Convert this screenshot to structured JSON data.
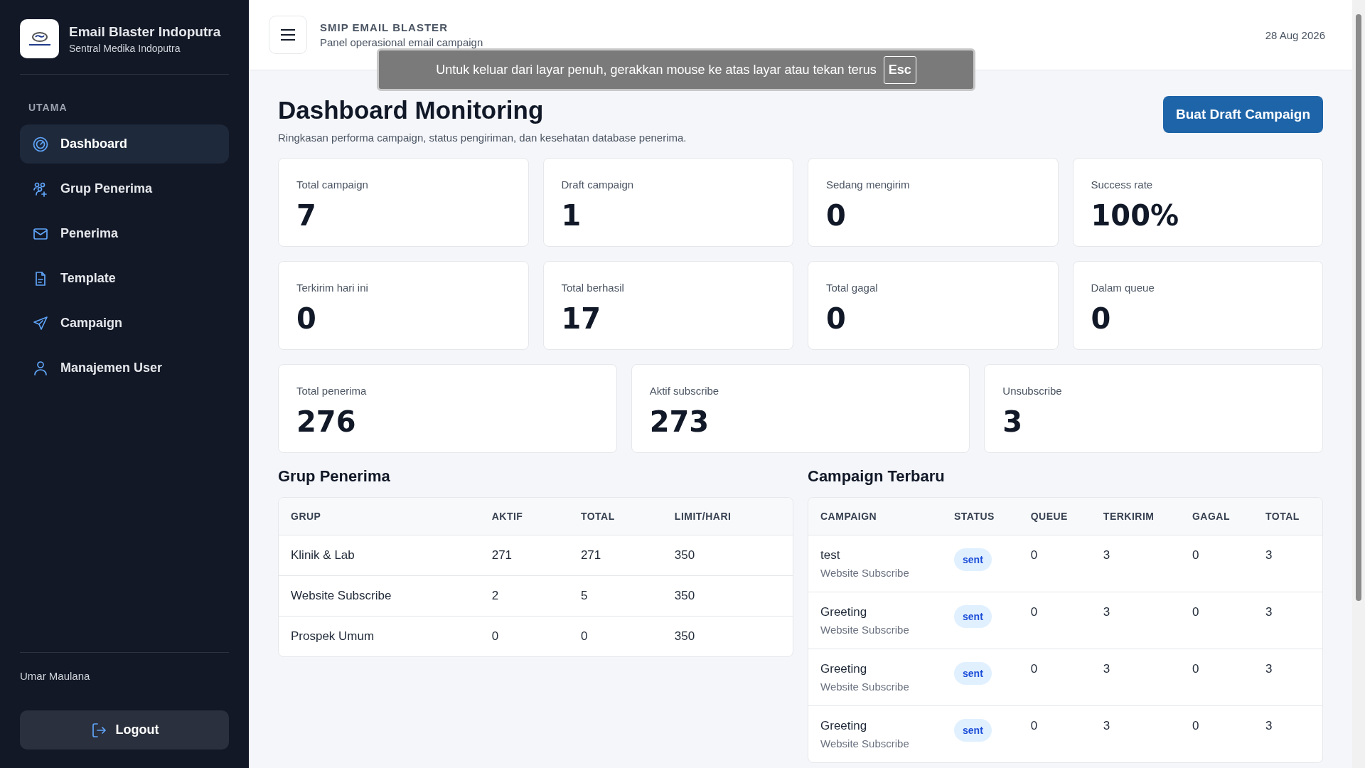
{
  "sidebar": {
    "brand": {
      "title": "Email Blaster Indoputra",
      "subtitle": "Sentral Medika Indoputra"
    },
    "section_label": "UTAMA",
    "items": [
      {
        "label": "Dashboard",
        "selected": true
      },
      {
        "label": "Grup Penerima",
        "selected": false
      },
      {
        "label": "Penerima",
        "selected": false
      },
      {
        "label": "Template",
        "selected": false
      },
      {
        "label": "Campaign",
        "selected": false
      },
      {
        "label": "Manajemen User",
        "selected": false
      }
    ],
    "user_name": "Umar Maulana",
    "logout": "Logout"
  },
  "header": {
    "title": "SMIP EMAIL BLASTER",
    "subtitle": "Panel operasional email campaign",
    "date": "28 Aug 2026"
  },
  "fullscreen_notice": {
    "text": "Untuk keluar dari layar penuh, gerakkan mouse ke atas layar atau tekan terus",
    "key": "Esc"
  },
  "page": {
    "title": "Dashboard Monitoring",
    "subtitle": "Ringkasan performa campaign, status pengiriman, dan kesehatan database penerima.",
    "action": "Buat Draft Campaign"
  },
  "stats_row_1": [
    {
      "label": "Total campaign",
      "value": "7"
    },
    {
      "label": "Draft campaign",
      "value": "1"
    },
    {
      "label": "Sedang mengirim",
      "value": "0"
    },
    {
      "label": "Success rate",
      "value": "100%"
    }
  ],
  "stats_row_2": [
    {
      "label": "Terkirim hari ini",
      "value": "0"
    },
    {
      "label": "Total berhasil",
      "value": "17"
    },
    {
      "label": "Total gagal",
      "value": "0"
    },
    {
      "label": "Dalam queue",
      "value": "0"
    }
  ],
  "stats_row_3": [
    {
      "label": "Total penerima",
      "value": "276"
    },
    {
      "label": "Aktif subscribe",
      "value": "273"
    },
    {
      "label": "Unsubscribe",
      "value": "3"
    }
  ],
  "groups": {
    "title": "Grup Penerima",
    "columns": [
      "GRUP",
      "AKTIF",
      "TOTAL",
      "LIMIT/HARI"
    ],
    "rows": [
      [
        "Klinik & Lab",
        "271",
        "271",
        "350"
      ],
      [
        "Website Subscribe",
        "2",
        "5",
        "350"
      ],
      [
        "Prospek Umum",
        "0",
        "0",
        "350"
      ]
    ]
  },
  "campaigns": {
    "title": "Campaign Terbaru",
    "columns": [
      "CAMPAIGN",
      "STATUS",
      "QUEUE",
      "TERKIRIM",
      "GAGAL",
      "TOTAL"
    ],
    "rows": [
      {
        "name": "test",
        "group": "Website Subscribe",
        "status": "sent",
        "queue": "0",
        "sent": "3",
        "failed": "0",
        "total": "3"
      },
      {
        "name": "Greeting",
        "group": "Website Subscribe",
        "status": "sent",
        "queue": "0",
        "sent": "3",
        "failed": "0",
        "total": "3"
      },
      {
        "name": "Greeting",
        "group": "Website Subscribe",
        "status": "sent",
        "queue": "0",
        "sent": "3",
        "failed": "0",
        "total": "3"
      },
      {
        "name": "Greeting",
        "group": "Website Subscribe",
        "status": "sent",
        "queue": "0",
        "sent": "3",
        "failed": "0",
        "total": "3"
      }
    ]
  }
}
